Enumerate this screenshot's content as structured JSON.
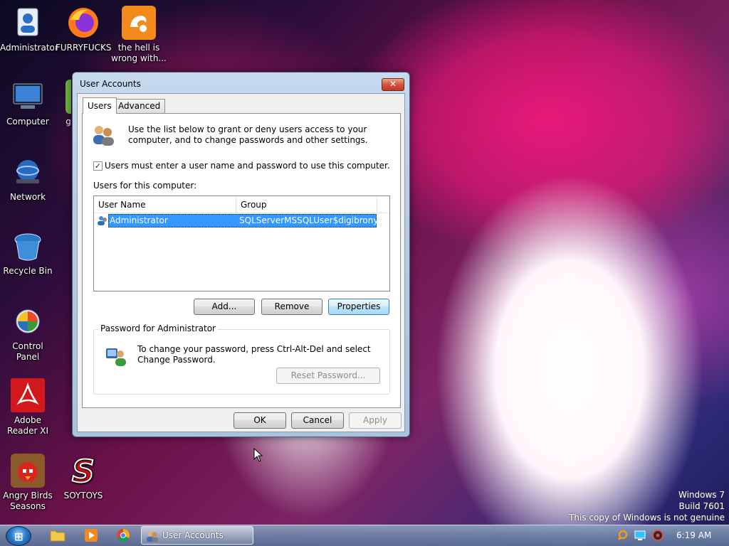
{
  "desktop": {
    "icons": [
      {
        "label": "Administrator"
      },
      {
        "label": "FURRYFUCKS"
      },
      {
        "label": "the hell is wrong with..."
      },
      {
        "label": "Computer"
      },
      {
        "label": "g"
      },
      {
        "label": "Network"
      },
      {
        "label": "Recycle Bin"
      },
      {
        "label": "Control Panel"
      },
      {
        "label": "Adobe Reader XI"
      },
      {
        "label": "Angry Birds Seasons"
      },
      {
        "label": "SOYTOYS"
      }
    ],
    "watermark": [
      "Windows 7",
      "Build 7601",
      "This copy of Windows is not genuine"
    ]
  },
  "dialog": {
    "title": "User Accounts",
    "close_label": "✕",
    "tabs": [
      {
        "label": "Users"
      },
      {
        "label": "Advanced"
      }
    ],
    "intro_text": "Use the list below to grant or deny users access to your computer, and to change passwords and other settings.",
    "require_login": {
      "checked": true,
      "label": "Users must enter a user name and password to use this computer."
    },
    "users_label": "Users for this computer:",
    "columns": [
      "User Name",
      "Group"
    ],
    "users": [
      {
        "name": "Administrator",
        "group": "SQLServerMSSQLUser$digibrony-..."
      }
    ],
    "buttons": {
      "add": "Add...",
      "remove": "Remove",
      "properties": "Properties"
    },
    "password_group": {
      "title": "Password for Administrator",
      "text": "To change your password, press Ctrl-Alt-Del and select Change Password.",
      "reset_button": "Reset Password..."
    },
    "footer": {
      "ok": "OK",
      "cancel": "Cancel",
      "apply": "Apply"
    }
  },
  "taskbar": {
    "active_task": "User Accounts",
    "clock": "6:19 AM"
  }
}
